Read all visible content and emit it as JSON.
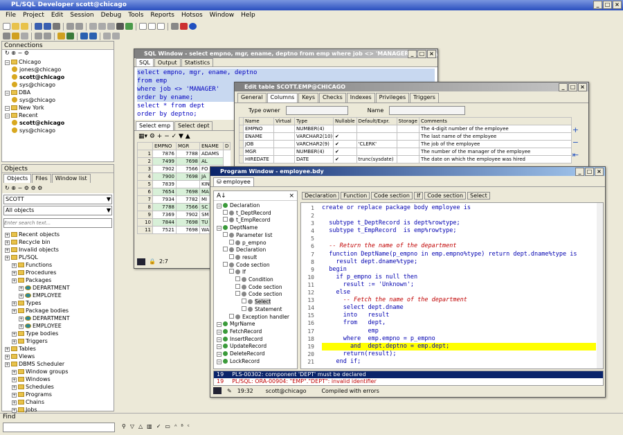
{
  "app": {
    "title": "PL/SQL Developer  scott@chicago"
  },
  "menu": [
    "File",
    "Project",
    "Edit",
    "Session",
    "Debug",
    "Tools",
    "Reports",
    "Hotsos",
    "Window",
    "Help"
  ],
  "connections": {
    "header": "Connections",
    "items": [
      {
        "label": "Chicago",
        "level": 0,
        "kind": "folder"
      },
      {
        "label": "jones@chicago",
        "level": 1,
        "kind": "db"
      },
      {
        "label": "scott@chicago",
        "level": 1,
        "kind": "db",
        "bold": true
      },
      {
        "label": "sys@chicago",
        "level": 1,
        "kind": "db"
      },
      {
        "label": "DBA",
        "level": 0,
        "kind": "folder"
      },
      {
        "label": "sys@chicago",
        "level": 1,
        "kind": "db"
      },
      {
        "label": "New York",
        "level": 0,
        "kind": "folder"
      },
      {
        "label": "Recent",
        "level": 0,
        "kind": "folder"
      },
      {
        "label": "scott@chicago",
        "level": 1,
        "kind": "db",
        "bold": true
      },
      {
        "label": "sys@chicago",
        "level": 1,
        "kind": "db"
      }
    ]
  },
  "objects": {
    "header": "Objects",
    "tabs": [
      "Objects",
      "Files",
      "Window list"
    ],
    "user": "SCOTT",
    "filter": "All objects",
    "search_placeholder": "Enter search text...",
    "items": [
      {
        "label": "Recent objects",
        "level": 0
      },
      {
        "label": "Recycle bin",
        "level": 0
      },
      {
        "label": "Invalid objects",
        "level": 0
      },
      {
        "label": "PL/SQL",
        "level": 0
      },
      {
        "label": "Functions",
        "level": 1
      },
      {
        "label": "Procedures",
        "level": 1
      },
      {
        "label": "Packages",
        "level": 1
      },
      {
        "label": "DEPARTMENT",
        "level": 2
      },
      {
        "label": "EMPLOYEE",
        "level": 2
      },
      {
        "label": "Types",
        "level": 1
      },
      {
        "label": "Package bodies",
        "level": 1
      },
      {
        "label": "DEPARTMENT",
        "level": 2
      },
      {
        "label": "EMPLOYEE",
        "level": 2
      },
      {
        "label": "Type bodies",
        "level": 1
      },
      {
        "label": "Triggers",
        "level": 1
      },
      {
        "label": "Tables",
        "level": 0
      },
      {
        "label": "Views",
        "level": 0
      },
      {
        "label": "DBMS Scheduler",
        "level": 0
      },
      {
        "label": "Window groups",
        "level": 1
      },
      {
        "label": "Windows",
        "level": 1
      },
      {
        "label": "Schedules",
        "level": 1
      },
      {
        "label": "Programs",
        "level": 1
      },
      {
        "label": "Chains",
        "level": 1
      },
      {
        "label": "Jobs",
        "level": 1
      }
    ]
  },
  "find": {
    "label": "Find"
  },
  "sqlwin": {
    "title": "SQL Window - select empno, mgr, ename, deptno from emp where job <> 'MANAGER' order by ename;",
    "tabs": [
      "SQL",
      "Output",
      "Statistics"
    ],
    "lines": [
      "select empno, mgr, ename, deptno",
      "from emp",
      "where job <> 'MANAGER'",
      "order by ename;",
      "select * from dept",
      "order by deptno;"
    ],
    "result_tabs": [
      "Select emp",
      "Select dept"
    ],
    "cols": [
      "EMPNO",
      "MGR",
      "ENAME",
      "D"
    ],
    "rows": [
      [
        "1",
        "7876",
        "7788",
        "ADAMS"
      ],
      [
        "2",
        "7499",
        "7698",
        "AL"
      ],
      [
        "3",
        "7902",
        "7566",
        "FO"
      ],
      [
        "4",
        "7900",
        "7698",
        "JA"
      ],
      [
        "5",
        "7839",
        "",
        "KIN"
      ],
      [
        "6",
        "7654",
        "7698",
        "MA"
      ],
      [
        "7",
        "7934",
        "7782",
        "MI"
      ],
      [
        "8",
        "7788",
        "7566",
        "SC"
      ],
      [
        "9",
        "7369",
        "7902",
        "SM"
      ],
      [
        "10",
        "7844",
        "7698",
        "TU"
      ],
      [
        "11",
        "7521",
        "7698",
        "WA"
      ]
    ],
    "status": "2:7"
  },
  "editwin": {
    "title": "Edit table SCOTT.EMP@CHICAGO",
    "tabs": [
      "General",
      "Columns",
      "Keys",
      "Checks",
      "Indexes",
      "Privileges",
      "Triggers"
    ],
    "type_owner_label": "Type owner",
    "name_label": "Name",
    "cols": [
      "Name",
      "Virtual",
      "Type",
      "Nullable",
      "Default/Expr.",
      "Storage",
      "Comments"
    ],
    "rows": [
      [
        "EMPNO",
        "",
        "NUMBER(4)",
        "",
        "",
        "",
        "The 4-digit number of the employee"
      ],
      [
        "ENAME",
        "",
        "VARCHAR2(10)",
        "✔",
        "",
        "",
        "The last name of the employee"
      ],
      [
        "JOB",
        "",
        "VARCHAR2(9)",
        "✔",
        "'CLERK'",
        "",
        "The job of the employee"
      ],
      [
        "MGR",
        "",
        "NUMBER(4)",
        "✔",
        "",
        "",
        "The number of the manager of the employee"
      ],
      [
        "HIREDATE",
        "",
        "DATE",
        "✔",
        "trunc(sysdate)",
        "",
        "The date on which the employee was hired"
      ]
    ]
  },
  "progwin": {
    "title": "Program Window - employee.bdy",
    "tab": "employee",
    "buttons": [
      "Declaration",
      "Function",
      "Code section",
      "If",
      "Code section",
      "Select"
    ],
    "tree": [
      {
        "label": "Declaration",
        "level": 0
      },
      {
        "label": "t_DeptRecord",
        "level": 1
      },
      {
        "label": "t_EmpRecord",
        "level": 1
      },
      {
        "label": "DeptName",
        "level": 0
      },
      {
        "label": "Parameter list",
        "level": 1
      },
      {
        "label": "p_empno",
        "level": 2
      },
      {
        "label": "Declaration",
        "level": 1
      },
      {
        "label": "result",
        "level": 2
      },
      {
        "label": "Code section",
        "level": 1
      },
      {
        "label": "If",
        "level": 2
      },
      {
        "label": "Condition",
        "level": 3
      },
      {
        "label": "Code section",
        "level": 3
      },
      {
        "label": "Code section",
        "level": 3
      },
      {
        "label": "Select",
        "level": 4,
        "sel": true
      },
      {
        "label": "Statement",
        "level": 4
      },
      {
        "label": "Exception handler",
        "level": 2
      },
      {
        "label": "MgrName",
        "level": 0
      },
      {
        "label": "FetchRecord",
        "level": 0
      },
      {
        "label": "InsertRecord",
        "level": 0
      },
      {
        "label": "UpdateRecord",
        "level": 0
      },
      {
        "label": "DeleteRecord",
        "level": 0
      },
      {
        "label": "LockRecord",
        "level": 0
      }
    ],
    "code": [
      "create or replace package body employee is",
      "",
      "  subtype t_DeptRecord is dept%rowtype;",
      "  subtype t_EmpRecord  is emp%rowtype;",
      "",
      "  -- Return the name of the department",
      "  function DeptName(p_empno in emp.empno%type) return dept.dname%type is",
      "    result dept.dname%type;",
      "  begin",
      "    if p_empno is null then",
      "      result := 'Unknown';",
      "    else",
      "      -- Fetch the name of the department",
      "      select dept.dname",
      "      into   result",
      "      from   dept,",
      "             emp",
      "      where  emp.empno = p_empno",
      "        and  dept.deptno = emp.dept;",
      "      return(result);",
      "    end if;"
    ],
    "highlight_line": 19,
    "errors": [
      {
        "line": "19",
        "msg": "PLS-00302: component 'DEPT' must be declared"
      },
      {
        "line": "19",
        "msg": "PL/SQL: ORA-00904: \"EMP\".\"DEPT\": invalid identifier"
      }
    ],
    "status": {
      "pos": "19:32",
      "conn": "scott@chicago",
      "msg": "Compiled with errors"
    }
  }
}
